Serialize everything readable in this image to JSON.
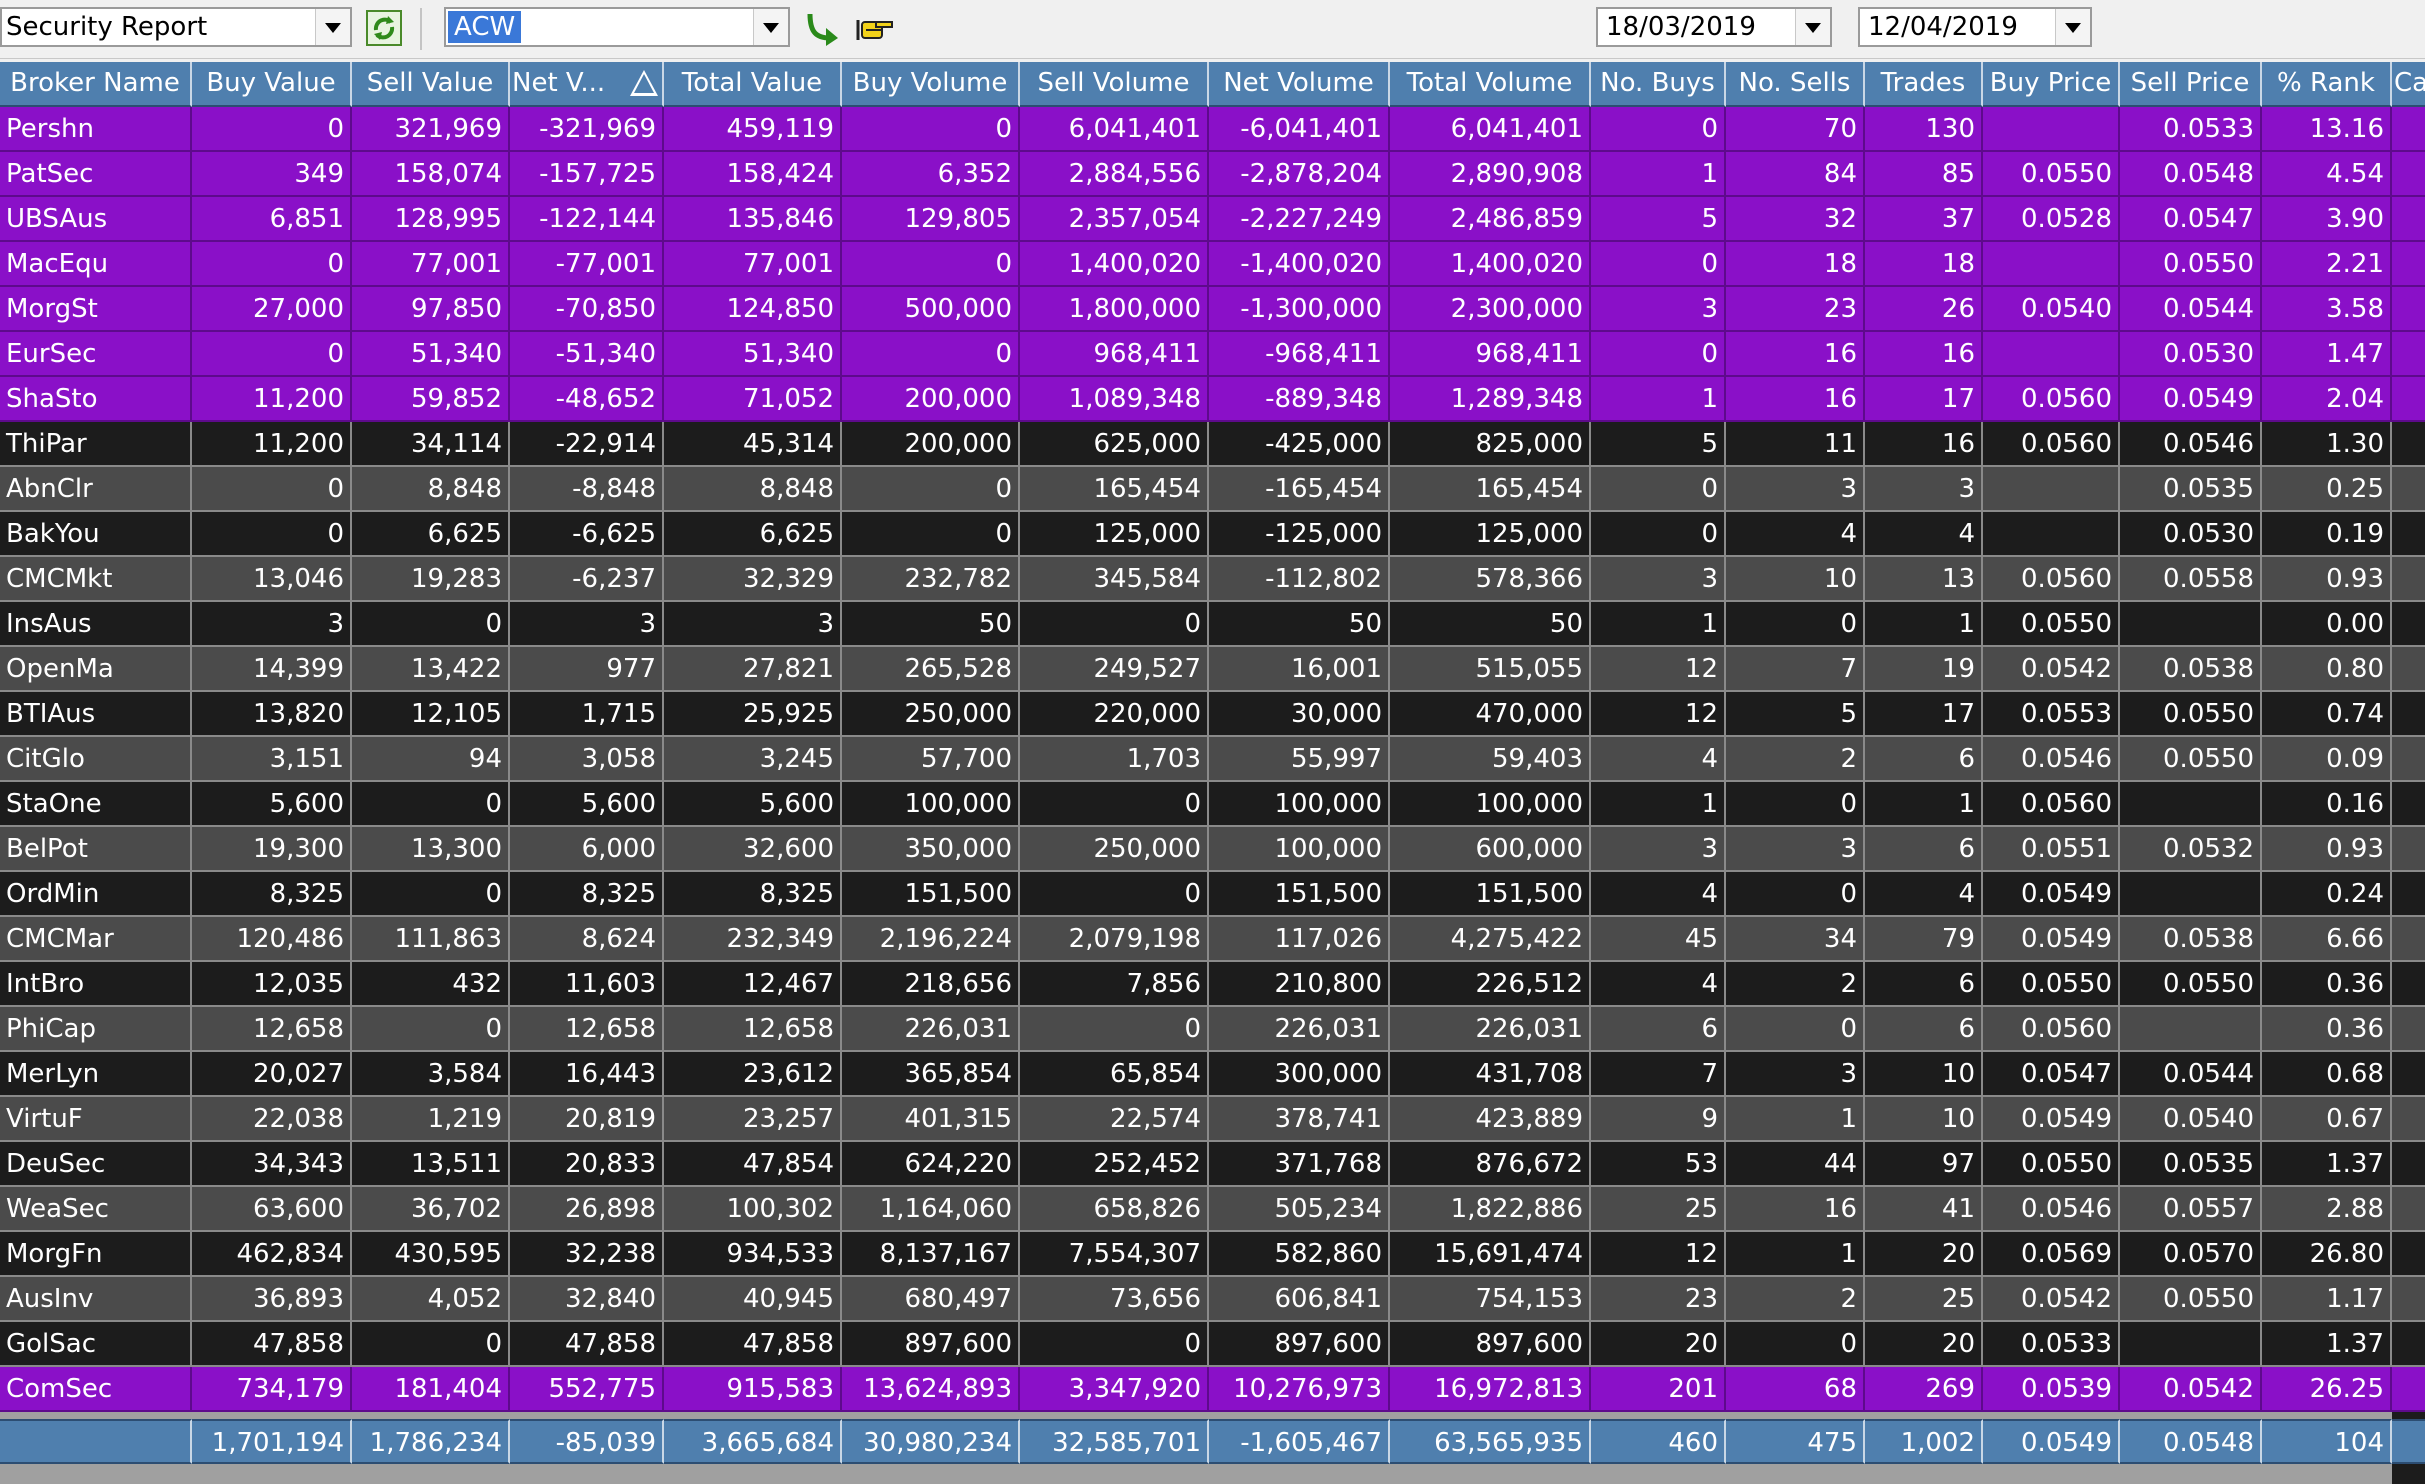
{
  "toolbar": {
    "report_select": "Security Report",
    "security_code": "ACW",
    "date_from": "18/03/2019",
    "date_to": "12/04/2019",
    "refresh_icon": "refresh-icon",
    "go_icon": "go-arrow-icon",
    "export_icon": "pointing-hand-icon"
  },
  "colors": {
    "header_bg": "#4f7fae",
    "highlight_row": "#8a10c8",
    "dark_row": "#1c1c1c",
    "gray_row": "#4b4b4b"
  },
  "grid": {
    "columns": [
      "Broker Name",
      "Buy Value",
      "Sell Value",
      "Net V...",
      "Total Value",
      "Buy Volume",
      "Sell Volume",
      "Net Volume",
      "Total Volume",
      "No. Buys",
      "No. Sells",
      "Trades",
      "Buy Price",
      "Sell Price",
      "% Rank",
      "Ca"
    ],
    "sort_column": 3,
    "sort_icon": "sort-ascending-icon",
    "rows": [
      {
        "style": "purple",
        "cells": [
          "Pershn",
          "0",
          "321,969",
          "-321,969",
          "459,119",
          "0",
          "6,041,401",
          "-6,041,401",
          "6,041,401",
          "0",
          "70",
          "130",
          "",
          "0.0533",
          "13.16",
          ""
        ]
      },
      {
        "style": "purple",
        "cells": [
          "PatSec",
          "349",
          "158,074",
          "-157,725",
          "158,424",
          "6,352",
          "2,884,556",
          "-2,878,204",
          "2,890,908",
          "1",
          "84",
          "85",
          "0.0550",
          "0.0548",
          "4.54",
          ""
        ]
      },
      {
        "style": "purple",
        "cells": [
          "UBSAus",
          "6,851",
          "128,995",
          "-122,144",
          "135,846",
          "129,805",
          "2,357,054",
          "-2,227,249",
          "2,486,859",
          "5",
          "32",
          "37",
          "0.0528",
          "0.0547",
          "3.90",
          ""
        ]
      },
      {
        "style": "purple",
        "cells": [
          "MacEqu",
          "0",
          "77,001",
          "-77,001",
          "77,001",
          "0",
          "1,400,020",
          "-1,400,020",
          "1,400,020",
          "0",
          "18",
          "18",
          "",
          "0.0550",
          "2.21",
          ""
        ]
      },
      {
        "style": "purple",
        "cells": [
          "MorgSt",
          "27,000",
          "97,850",
          "-70,850",
          "124,850",
          "500,000",
          "1,800,000",
          "-1,300,000",
          "2,300,000",
          "3",
          "23",
          "26",
          "0.0540",
          "0.0544",
          "3.58",
          ""
        ]
      },
      {
        "style": "purple",
        "cells": [
          "EurSec",
          "0",
          "51,340",
          "-51,340",
          "51,340",
          "0",
          "968,411",
          "-968,411",
          "968,411",
          "0",
          "16",
          "16",
          "",
          "0.0530",
          "1.47",
          ""
        ]
      },
      {
        "style": "purple",
        "cells": [
          "ShaSto",
          "11,200",
          "59,852",
          "-48,652",
          "71,052",
          "200,000",
          "1,089,348",
          "-889,348",
          "1,289,348",
          "1",
          "16",
          "17",
          "0.0560",
          "0.0549",
          "2.04",
          ""
        ]
      },
      {
        "style": "dark",
        "cells": [
          "ThiPar",
          "11,200",
          "34,114",
          "-22,914",
          "45,314",
          "200,000",
          "625,000",
          "-425,000",
          "825,000",
          "5",
          "11",
          "16",
          "0.0560",
          "0.0546",
          "1.30",
          ""
        ]
      },
      {
        "style": "gray",
        "cells": [
          "AbnClr",
          "0",
          "8,848",
          "-8,848",
          "8,848",
          "0",
          "165,454",
          "-165,454",
          "165,454",
          "0",
          "3",
          "3",
          "",
          "0.0535",
          "0.25",
          ""
        ]
      },
      {
        "style": "dark",
        "cells": [
          "BakYou",
          "0",
          "6,625",
          "-6,625",
          "6,625",
          "0",
          "125,000",
          "-125,000",
          "125,000",
          "0",
          "4",
          "4",
          "",
          "0.0530",
          "0.19",
          ""
        ]
      },
      {
        "style": "gray",
        "cells": [
          "CMCMkt",
          "13,046",
          "19,283",
          "-6,237",
          "32,329",
          "232,782",
          "345,584",
          "-112,802",
          "578,366",
          "3",
          "10",
          "13",
          "0.0560",
          "0.0558",
          "0.93",
          ""
        ]
      },
      {
        "style": "dark",
        "cells": [
          "InsAus",
          "3",
          "0",
          "3",
          "3",
          "50",
          "0",
          "50",
          "50",
          "1",
          "0",
          "1",
          "0.0550",
          "",
          "0.00",
          ""
        ]
      },
      {
        "style": "gray",
        "cells": [
          "OpenMa",
          "14,399",
          "13,422",
          "977",
          "27,821",
          "265,528",
          "249,527",
          "16,001",
          "515,055",
          "12",
          "7",
          "19",
          "0.0542",
          "0.0538",
          "0.80",
          ""
        ]
      },
      {
        "style": "dark",
        "cells": [
          "BTIAus",
          "13,820",
          "12,105",
          "1,715",
          "25,925",
          "250,000",
          "220,000",
          "30,000",
          "470,000",
          "12",
          "5",
          "17",
          "0.0553",
          "0.0550",
          "0.74",
          ""
        ]
      },
      {
        "style": "gray",
        "cells": [
          "CitGlo",
          "3,151",
          "94",
          "3,058",
          "3,245",
          "57,700",
          "1,703",
          "55,997",
          "59,403",
          "4",
          "2",
          "6",
          "0.0546",
          "0.0550",
          "0.09",
          ""
        ]
      },
      {
        "style": "dark",
        "cells": [
          "StaOne",
          "5,600",
          "0",
          "5,600",
          "5,600",
          "100,000",
          "0",
          "100,000",
          "100,000",
          "1",
          "0",
          "1",
          "0.0560",
          "",
          "0.16",
          ""
        ]
      },
      {
        "style": "gray",
        "cells": [
          "BelPot",
          "19,300",
          "13,300",
          "6,000",
          "32,600",
          "350,000",
          "250,000",
          "100,000",
          "600,000",
          "3",
          "3",
          "6",
          "0.0551",
          "0.0532",
          "0.93",
          ""
        ]
      },
      {
        "style": "dark",
        "cells": [
          "OrdMin",
          "8,325",
          "0",
          "8,325",
          "8,325",
          "151,500",
          "0",
          "151,500",
          "151,500",
          "4",
          "0",
          "4",
          "0.0549",
          "",
          "0.24",
          ""
        ]
      },
      {
        "style": "gray",
        "cells": [
          "CMCMar",
          "120,486",
          "111,863",
          "8,624",
          "232,349",
          "2,196,224",
          "2,079,198",
          "117,026",
          "4,275,422",
          "45",
          "34",
          "79",
          "0.0549",
          "0.0538",
          "6.66",
          ""
        ]
      },
      {
        "style": "dark",
        "cells": [
          "IntBro",
          "12,035",
          "432",
          "11,603",
          "12,467",
          "218,656",
          "7,856",
          "210,800",
          "226,512",
          "4",
          "2",
          "6",
          "0.0550",
          "0.0550",
          "0.36",
          ""
        ]
      },
      {
        "style": "gray",
        "cells": [
          "PhiCap",
          "12,658",
          "0",
          "12,658",
          "12,658",
          "226,031",
          "0",
          "226,031",
          "226,031",
          "6",
          "0",
          "6",
          "0.0560",
          "",
          "0.36",
          ""
        ]
      },
      {
        "style": "dark",
        "cells": [
          "MerLyn",
          "20,027",
          "3,584",
          "16,443",
          "23,612",
          "365,854",
          "65,854",
          "300,000",
          "431,708",
          "7",
          "3",
          "10",
          "0.0547",
          "0.0544",
          "0.68",
          ""
        ]
      },
      {
        "style": "gray",
        "cells": [
          "VirtuF",
          "22,038",
          "1,219",
          "20,819",
          "23,257",
          "401,315",
          "22,574",
          "378,741",
          "423,889",
          "9",
          "1",
          "10",
          "0.0549",
          "0.0540",
          "0.67",
          ""
        ]
      },
      {
        "style": "dark",
        "cells": [
          "DeuSec",
          "34,343",
          "13,511",
          "20,833",
          "47,854",
          "624,220",
          "252,452",
          "371,768",
          "876,672",
          "53",
          "44",
          "97",
          "0.0550",
          "0.0535",
          "1.37",
          ""
        ]
      },
      {
        "style": "gray",
        "cells": [
          "WeaSec",
          "63,600",
          "36,702",
          "26,898",
          "100,302",
          "1,164,060",
          "658,826",
          "505,234",
          "1,822,886",
          "25",
          "16",
          "41",
          "0.0546",
          "0.0557",
          "2.88",
          ""
        ]
      },
      {
        "style": "dark",
        "cells": [
          "MorgFn",
          "462,834",
          "430,595",
          "32,238",
          "934,533",
          "8,137,167",
          "7,554,307",
          "582,860",
          "15,691,474",
          "12",
          "1",
          "20",
          "0.0569",
          "0.0570",
          "26.80",
          ""
        ]
      },
      {
        "style": "gray",
        "cells": [
          "AusInv",
          "36,893",
          "4,052",
          "32,840",
          "40,945",
          "680,497",
          "73,656",
          "606,841",
          "754,153",
          "23",
          "2",
          "25",
          "0.0542",
          "0.0550",
          "1.17",
          ""
        ]
      },
      {
        "style": "dark",
        "cells": [
          "GolSac",
          "47,858",
          "0",
          "47,858",
          "47,858",
          "897,600",
          "0",
          "897,600",
          "897,600",
          "20",
          "0",
          "20",
          "0.0533",
          "",
          "1.37",
          ""
        ]
      },
      {
        "style": "purple",
        "cells": [
          "ComSec",
          "734,179",
          "181,404",
          "552,775",
          "915,583",
          "13,624,893",
          "3,347,920",
          "10,276,973",
          "16,972,813",
          "201",
          "68",
          "269",
          "0.0539",
          "0.0542",
          "26.25",
          ""
        ]
      }
    ],
    "totals": [
      "",
      "1,701,194",
      "1,786,234",
      "-85,039",
      "3,665,684",
      "30,980,234",
      "32,585,701",
      "-1,605,467",
      "63,565,935",
      "460",
      "475",
      "1,002",
      "0.0549",
      "0.0548",
      "104",
      ""
    ]
  }
}
